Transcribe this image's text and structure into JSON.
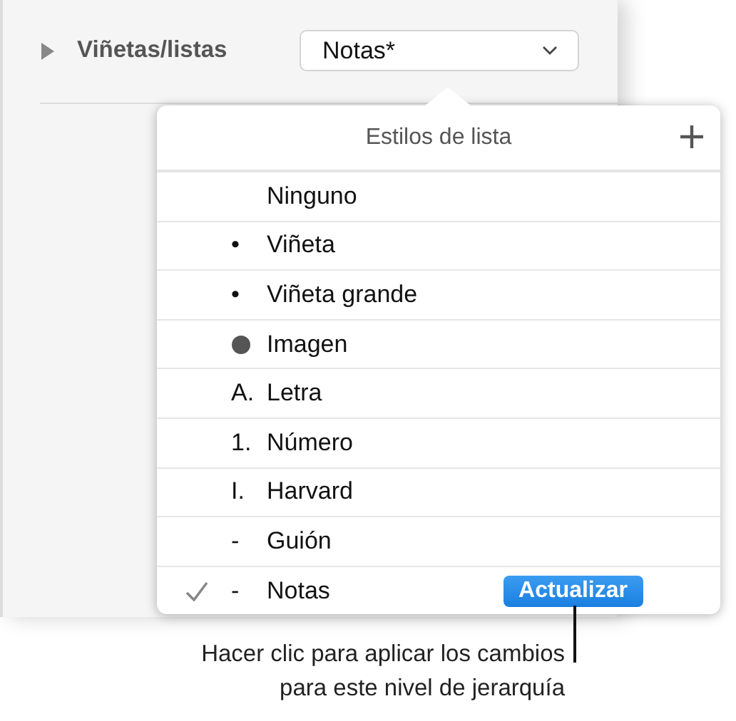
{
  "section": {
    "label": "Viñetas/listas",
    "expanded": false
  },
  "style_dropdown": {
    "value": "Notas*"
  },
  "popover": {
    "title": "Estilos de lista",
    "items": [
      {
        "kind": "none",
        "marker": "",
        "label": "Ninguno",
        "checked": false
      },
      {
        "kind": "text",
        "marker": "•",
        "label": "Viñeta",
        "checked": false
      },
      {
        "kind": "text",
        "marker": "•",
        "label": "Viñeta grande",
        "checked": false
      },
      {
        "kind": "image",
        "marker": "",
        "label": "Imagen",
        "checked": false
      },
      {
        "kind": "text",
        "marker": "A.",
        "label": "Letra",
        "checked": false
      },
      {
        "kind": "text",
        "marker": "1.",
        "label": "Número",
        "checked": false
      },
      {
        "kind": "text",
        "marker": "I.",
        "label": "Harvard",
        "checked": false
      },
      {
        "kind": "text",
        "marker": "-",
        "label": "Guión",
        "checked": false
      },
      {
        "kind": "text",
        "marker": "-",
        "label": "Notas",
        "checked": true,
        "button": "Actualizar"
      }
    ]
  },
  "callout": {
    "lines": [
      "Hacer clic para aplicar los cambios",
      "para este nivel de jerarquía"
    ]
  }
}
